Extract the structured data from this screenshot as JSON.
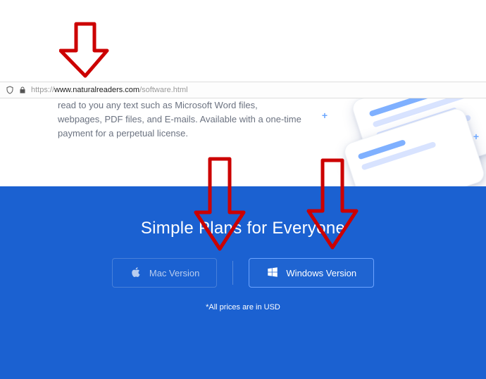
{
  "url": {
    "prefix": "https://",
    "domain": "www.naturalreaders.com",
    "path": "/software.html"
  },
  "hero": {
    "text": "read to you any text such as Microsoft Word files, webpages, PDF files, and E-mails. Available with a one-time payment for a perpetual license."
  },
  "pricing": {
    "title": "Simple Plans for Everyone",
    "mac_label": "Mac Version",
    "windows_label": "Windows Version",
    "footnote": "*All prices are in USD"
  },
  "annotations": {
    "arrow_count": 3,
    "color": "#cc0000"
  }
}
